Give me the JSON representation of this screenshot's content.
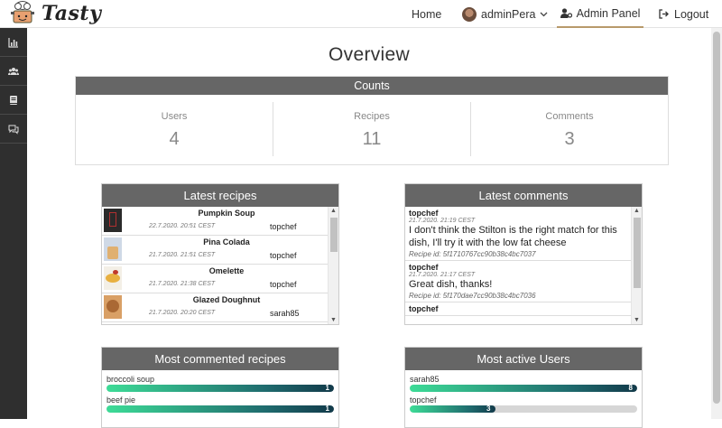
{
  "navbar": {
    "brand": "Tasty",
    "home": "Home",
    "user": "adminPera",
    "admin_panel": "Admin Panel",
    "logout": "Logout"
  },
  "sidebar": {
    "items": [
      {
        "icon": "chart-icon"
      },
      {
        "icon": "users-icon"
      },
      {
        "icon": "book-icon"
      },
      {
        "icon": "comments-icon"
      }
    ]
  },
  "page": {
    "title": "Overview"
  },
  "counts": {
    "header": "Counts",
    "cells": [
      {
        "label": "Users",
        "value": "4"
      },
      {
        "label": "Recipes",
        "value": "11"
      },
      {
        "label": "Comments",
        "value": "3"
      }
    ]
  },
  "latest_recipes": {
    "header": "Latest recipes",
    "items": [
      {
        "name": "Pumpkin Soup",
        "date": "22.7.2020. 20:51 CEST",
        "author": "topchef",
        "thumb_color": "#2a2a2a",
        "thumb_accent": "#b03030"
      },
      {
        "name": "Pina Colada",
        "date": "21.7.2020. 21:51 CEST",
        "author": "topchef",
        "thumb_color": "#cfd9e6",
        "thumb_accent": "#e0b070"
      },
      {
        "name": "Omelette",
        "date": "21.7.2020. 21:38 CEST",
        "author": "topchef",
        "thumb_color": "#f3efe6",
        "thumb_accent": "#c0392b"
      },
      {
        "name": "Glazed Doughnut",
        "date": "21.7.2020. 20:20 CEST",
        "author": "sarah85",
        "thumb_color": "#d9a066",
        "thumb_accent": "#8b4513"
      }
    ]
  },
  "latest_comments": {
    "header": "Latest comments",
    "items": [
      {
        "author": "topchef",
        "date": "21.7.2020. 21:19 CEST",
        "text": "I don't think the Stilton is the right match for this dish, I'll try it with the low fat cheese",
        "recipe_id": "Recipe id: 5f1710767cc90b38c4bc7037"
      },
      {
        "author": "topchef",
        "date": "21.7.2020. 21:17 CEST",
        "text": "Great dish, thanks!",
        "recipe_id": "Recipe id: 5f170dae7cc90b38c4bc7036"
      },
      {
        "author": "topchef",
        "date": "",
        "text": "",
        "recipe_id": ""
      }
    ]
  },
  "most_commented": {
    "header": "Most commented recipes",
    "items": [
      {
        "label": "broccoli soup",
        "value": "1",
        "fraction": 1.0
      },
      {
        "label": "beef pie",
        "value": "1",
        "fraction": 1.0
      }
    ]
  },
  "most_active": {
    "header": "Most active Users",
    "items": [
      {
        "label": "sarah85",
        "value": "8",
        "fraction": 1.0
      },
      {
        "label": "topchef",
        "value": "3",
        "fraction": 0.375
      }
    ]
  }
}
